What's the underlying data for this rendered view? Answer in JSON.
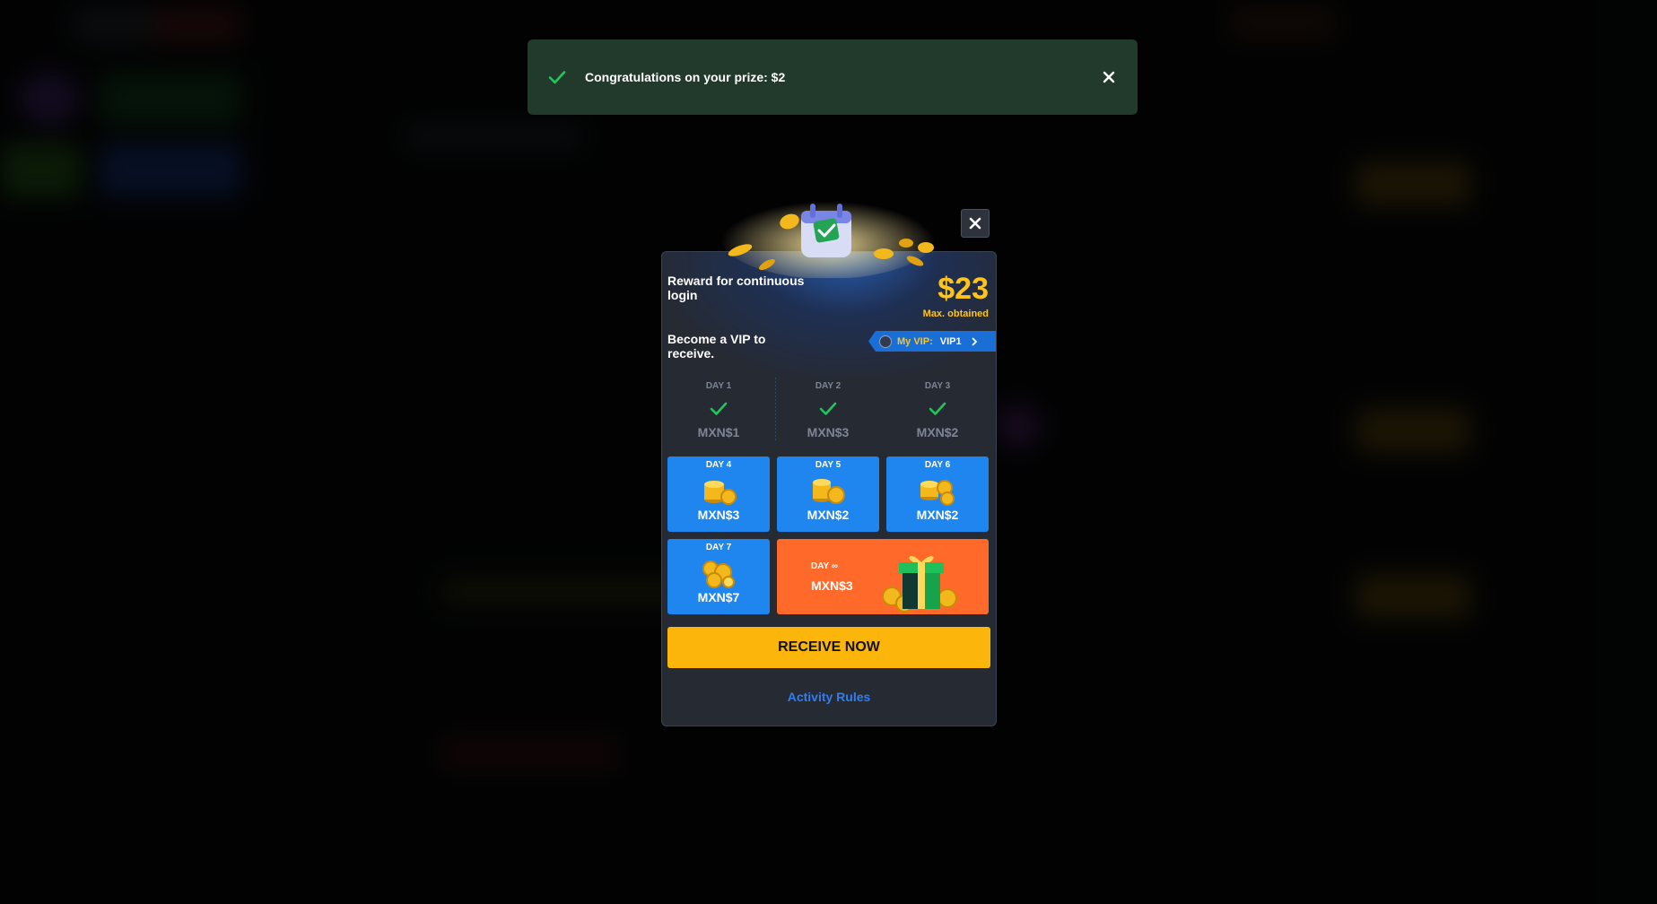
{
  "colors": {
    "accent_gold": "#ffc41a",
    "card_blue": "#1f86f0",
    "card_orange": "#ff6a2a",
    "button_yellow": "#fbb50b",
    "link_blue": "#2f7ef2",
    "success_green": "#22c55e",
    "toast_bg": "#223a2c",
    "modal_bg": "#262a33"
  },
  "toast": {
    "message": "Congratulations on your prize: $2",
    "icon": "check-icon",
    "close_icon": "close-icon"
  },
  "modal": {
    "title": "Reward for continuous login",
    "max_amount": "$23",
    "max_label": "Max. obtained",
    "vip_note": "Become a VIP to receive.",
    "vip_badge": {
      "label": "My VIP:",
      "level": "VIP1",
      "icon": "chevron-right-icon"
    },
    "days_claimed": [
      {
        "label": "DAY 1",
        "amount": "MXN$1"
      },
      {
        "label": "DAY 2",
        "amount": "MXN$3"
      },
      {
        "label": "DAY 3",
        "amount": "MXN$2"
      }
    ],
    "days_pending": [
      {
        "label": "DAY 4",
        "amount": "MXN$3"
      },
      {
        "label": "DAY 5",
        "amount": "MXN$2"
      },
      {
        "label": "DAY 6",
        "amount": "MXN$2"
      },
      {
        "label": "DAY 7",
        "amount": "MXN$7"
      }
    ],
    "day_infinite": {
      "label": "DAY ∞",
      "amount": "MXN$3"
    },
    "receive_button": "RECEIVE NOW",
    "rules_link": "Activity Rules"
  }
}
